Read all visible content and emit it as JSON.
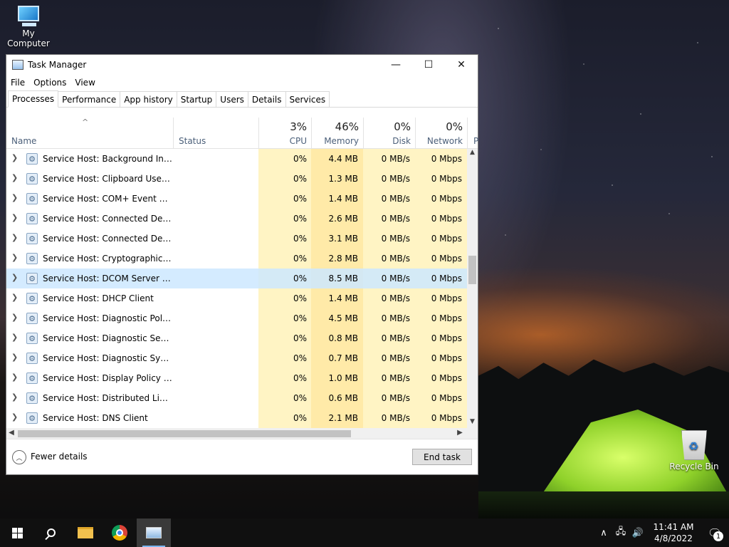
{
  "desktop": {
    "icons": [
      {
        "label": "My Computer",
        "icon": "computer-icon"
      },
      {
        "label": "Recycle Bin",
        "icon": "recycle-bin-icon"
      }
    ]
  },
  "window": {
    "title": "Task Manager",
    "controls": {
      "minimize": "—",
      "maximize": "☐",
      "close": "✕"
    },
    "menu": [
      "File",
      "Options",
      "View"
    ],
    "tabs": [
      "Processes",
      "Performance",
      "App history",
      "Startup",
      "Users",
      "Details",
      "Services"
    ],
    "active_tab": "Processes",
    "sort_indicator": "^",
    "columns": {
      "name": {
        "label": "Name"
      },
      "status": {
        "label": "Status"
      },
      "cpu": {
        "label": "CPU",
        "pct": "3%"
      },
      "memory": {
        "label": "Memory",
        "pct": "46%"
      },
      "disk": {
        "label": "Disk",
        "pct": "0%"
      },
      "network": {
        "label": "Network",
        "pct": "0%"
      },
      "power": {
        "label": "P"
      }
    },
    "rows": [
      {
        "name": "Service Host: Background Intelli...",
        "cpu": "0%",
        "memory": "4.4 MB",
        "disk": "0 MB/s",
        "network": "0 Mbps"
      },
      {
        "name": "Service Host: Clipboard User Ser...",
        "cpu": "0%",
        "memory": "1.3 MB",
        "disk": "0 MB/s",
        "network": "0 Mbps"
      },
      {
        "name": "Service Host: COM+ Event Syste...",
        "cpu": "0%",
        "memory": "1.4 MB",
        "disk": "0 MB/s",
        "network": "0 Mbps"
      },
      {
        "name": "Service Host: Connected Device...",
        "cpu": "0%",
        "memory": "2.6 MB",
        "disk": "0 MB/s",
        "network": "0 Mbps"
      },
      {
        "name": "Service Host: Connected Device...",
        "cpu": "0%",
        "memory": "3.1 MB",
        "disk": "0 MB/s",
        "network": "0 Mbps"
      },
      {
        "name": "Service Host: Cryptographic Ser...",
        "cpu": "0%",
        "memory": "2.8 MB",
        "disk": "0 MB/s",
        "network": "0 Mbps"
      },
      {
        "name": "Service Host: DCOM Server Proc...",
        "cpu": "0%",
        "memory": "8.5 MB",
        "disk": "0 MB/s",
        "network": "0 Mbps",
        "selected": true
      },
      {
        "name": "Service Host: DHCP Client",
        "cpu": "0%",
        "memory": "1.4 MB",
        "disk": "0 MB/s",
        "network": "0 Mbps"
      },
      {
        "name": "Service Host: Diagnostic Policy ...",
        "cpu": "0%",
        "memory": "4.5 MB",
        "disk": "0 MB/s",
        "network": "0 Mbps"
      },
      {
        "name": "Service Host: Diagnostic Service...",
        "cpu": "0%",
        "memory": "0.8 MB",
        "disk": "0 MB/s",
        "network": "0 Mbps"
      },
      {
        "name": "Service Host: Diagnostic System...",
        "cpu": "0%",
        "memory": "0.7 MB",
        "disk": "0 MB/s",
        "network": "0 Mbps"
      },
      {
        "name": "Service Host: Display Policy Serv...",
        "cpu": "0%",
        "memory": "1.0 MB",
        "disk": "0 MB/s",
        "network": "0 Mbps"
      },
      {
        "name": "Service Host: Distributed Link Tr...",
        "cpu": "0%",
        "memory": "0.6 MB",
        "disk": "0 MB/s",
        "network": "0 Mbps"
      },
      {
        "name": "Service Host: DNS Client",
        "cpu": "0%",
        "memory": "2.1 MB",
        "disk": "0 MB/s",
        "network": "0 Mbps"
      }
    ],
    "footer": {
      "fewer_details": "Fewer details",
      "end_task": "End task"
    }
  },
  "taskbar": {
    "apps": [
      {
        "name": "start",
        "icon": "windows-logo-icon"
      },
      {
        "name": "search",
        "icon": "search-icon"
      },
      {
        "name": "file-explorer",
        "icon": "folder-icon"
      },
      {
        "name": "chrome",
        "icon": "chrome-icon"
      },
      {
        "name": "task-manager",
        "icon": "task-manager-icon",
        "active": true
      }
    ],
    "tray": {
      "chevron": "∧",
      "network": "🖧",
      "volume": "🔊",
      "time": "11:41 AM",
      "date": "4/8/2022",
      "notification_count": "1"
    }
  }
}
